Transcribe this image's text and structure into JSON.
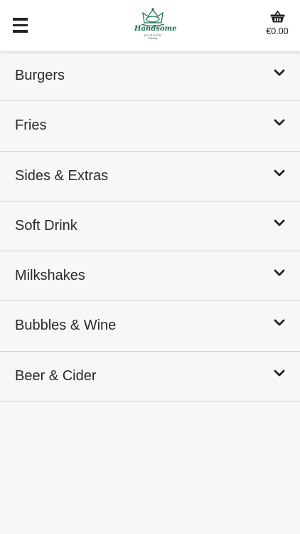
{
  "header": {
    "menu_icon": "hamburger-menu-icon",
    "logo": {
      "main": "Handsome",
      "sub": "BURGER",
      "location": "Galway"
    },
    "basket_icon": "basket-icon",
    "basket_total": "€0.00"
  },
  "categories": [
    {
      "label": "Burgers"
    },
    {
      "label": "Fries"
    },
    {
      "label": "Sides & Extras"
    },
    {
      "label": "Soft Drink"
    },
    {
      "label": "Milkshakes"
    },
    {
      "label": "Bubbles & Wine"
    },
    {
      "label": "Beer & Cider"
    }
  ],
  "colors": {
    "brand_green": "#1d6b4a",
    "background": "#f7f7f7",
    "divider": "#d3d3d3"
  }
}
